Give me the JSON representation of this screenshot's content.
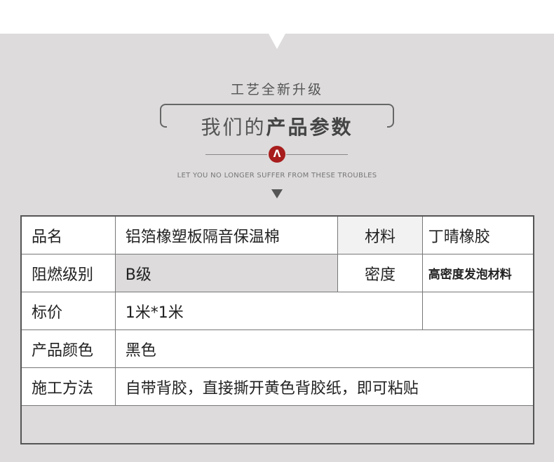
{
  "header": {
    "subtitle": "工艺全新升级",
    "title_normal": "我们的",
    "title_bold": "产品参数",
    "badge": "Λ",
    "tagline": "LET YOU NO LONGER SUFFER FROM THESE TROUBLES"
  },
  "table": {
    "rows": [
      [
        "品名",
        "铝箔橡塑板隔音保温棉",
        "材料",
        "丁晴橡胶"
      ],
      [
        "阻燃级别",
        "B级",
        "密度",
        "高密度发泡材料"
      ],
      [
        "标价",
        "1米*1米",
        "",
        ""
      ],
      [
        "产品颜色",
        "黑色"
      ],
      [
        "施工方法",
        "自带背胶，直接撕开黄色背胶纸，即可粘贴"
      ]
    ]
  }
}
